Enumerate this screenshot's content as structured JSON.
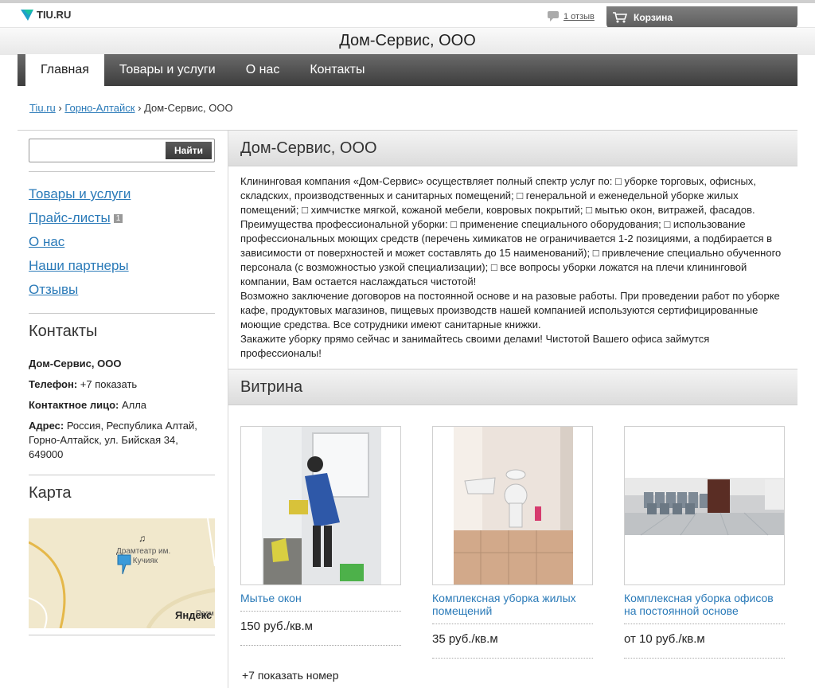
{
  "topbar": {
    "logo_text": "TIU.RU",
    "reviews_label": "1 отзыв",
    "cart_label": "Корзина"
  },
  "header": {
    "title": "Дом-Сервис, ООО"
  },
  "nav": {
    "items": [
      {
        "label": "Главная",
        "active": true
      },
      {
        "label": "Товары и услуги"
      },
      {
        "label": "О нас"
      },
      {
        "label": "Контакты"
      }
    ]
  },
  "breadcrumb": {
    "items": [
      "Tiu.ru",
      "Горно-Алтайск",
      "Дом-Сервис, ООО"
    ],
    "sep": "›"
  },
  "search": {
    "value": "",
    "placeholder": "",
    "button_label": "Найти"
  },
  "sidebar": {
    "menu": [
      {
        "label": "Товары и услуги"
      },
      {
        "label": "Прайс-листы",
        "badge": "1"
      },
      {
        "label": "О нас"
      },
      {
        "label": "Наши партнеры"
      },
      {
        "label": "Отзывы"
      }
    ],
    "contacts_title": "Контакты",
    "company": "Дом-Сервис, ООО",
    "phone_label": "Телефон:",
    "phone_value": "+7 показать",
    "contact_person_label": "Контактное лицо:",
    "contact_person_value": "Алла",
    "address_label": "Адрес:",
    "address_value": "Россия, Республика Алтай, Горно-Алтайск, ул. Бийская 34, 649000",
    "map_title": "Карта",
    "map": {
      "place_label_1": "Драмтеатр им.",
      "place_label_2": "П. Кучияк",
      "brand": "Яндекс",
      "corner": "Подм"
    }
  },
  "main": {
    "about_title": "Дом-Сервис, ООО",
    "about_paragraphs": [
      "Клининговая компания «Дом-Сервис» осуществляет полный спектр услуг по: □ уборке торговых, офисных, складских, производственных и санитарных помещений; □ генеральной и еженедельной уборке жилых помещений; □ химчистке мягкой, кожаной мебели, ковровых покрытий; □ мытью окон, витражей, фасадов.",
      "Преимущества профессиональной уборки: □ применение специального оборудования; □ использование профессиональных моющих средств (перечень химикатов не ограничивается 1-2 позициями, а подбирается в зависимости от поверхностей и может составлять до 15 наименований); □ привлечение специально обученного персонала (с возможностью узкой специализации); □ все вопросы уборки ложатся на плечи клининговой компании, Вам остается наслаждаться чистотой!",
      "Возможно заключение договоров на постоянной основе и на разовые работы. При проведении работ по уборке кафе, продуктовых магазинов, пищевых производств нашей компанией используются сертифицированные моющие средства. Все сотрудники имеют санитарные книжки.",
      "Закажите уборку прямо сейчас и занимайтесь своими делами! Чистотой Вашего офиса займутся профессионалы!"
    ],
    "showcase_title": "Витрина",
    "products": [
      {
        "title": "Мытье окон",
        "price": "150 руб./кв.м"
      },
      {
        "title": "Комплексная уборка жилых помещений",
        "price": "35 руб./кв.м"
      },
      {
        "title": "Комплексная уборка офисов на постоянной основе",
        "price": "от 10 руб./кв.м"
      }
    ],
    "phone_link": "+7 показать номер"
  }
}
